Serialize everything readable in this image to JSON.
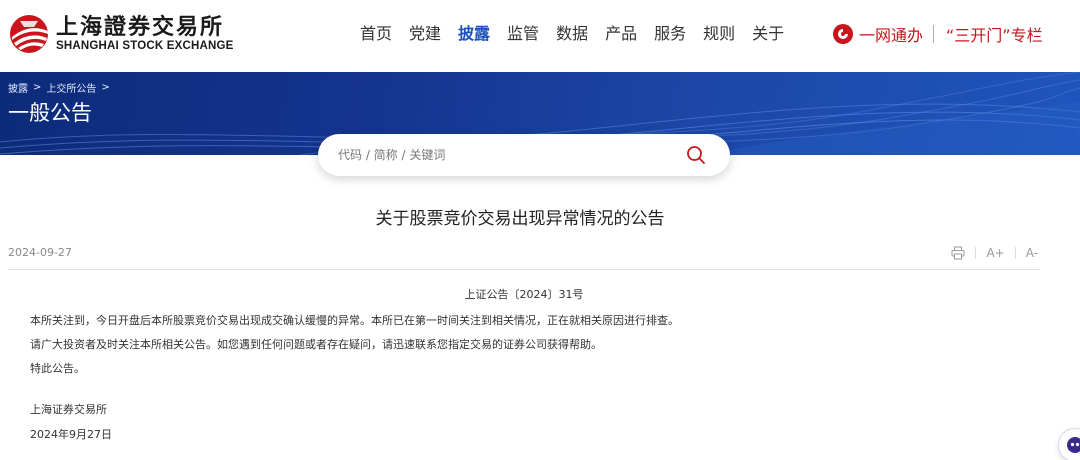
{
  "header": {
    "logo": {
      "cn": "上海證券交易所",
      "en": "SHANGHAI STOCK EXCHANGE",
      "brand_color": "#c8161d"
    },
    "nav": [
      {
        "label": "首页",
        "active": false
      },
      {
        "label": "党建",
        "active": false
      },
      {
        "label": "披露",
        "active": true
      },
      {
        "label": "监管",
        "active": false
      },
      {
        "label": "数据",
        "active": false
      },
      {
        "label": "产品",
        "active": false
      },
      {
        "label": "服务",
        "active": false
      },
      {
        "label": "规则",
        "active": false
      },
      {
        "label": "关于",
        "active": false
      }
    ],
    "quick_links": {
      "yiwangtong": "一网通办",
      "sankaimen": "“三开门”专栏",
      "icon": "seal-icon",
      "color": "#c8161d"
    },
    "active_color": "#1d52bd"
  },
  "banner": {
    "breadcrumb": [
      "披露",
      "上交所公告"
    ],
    "title": "一般公告",
    "color": "#14358f"
  },
  "search": {
    "placeholder": "代码 / 简称 / 关键词",
    "value": "",
    "icon": "search-icon",
    "icon_color": "#c8161d"
  },
  "article": {
    "title": "关于股票竞价交易出现异常情况的公告",
    "date": "2024-09-27",
    "tools": {
      "print_icon": "printer-icon",
      "font_increase": "A+",
      "font_decrease": "A-"
    },
    "doc_number": "上证公告〔2024〕31号",
    "paragraphs": [
      "本所关注到，今日开盘后本所股票竞价交易出现成交确认缓慢的异常。本所已在第一时间关注到相关情况，正在就相关原因进行排查。",
      "请广大投资者及时关注本所相关公告。如您遇到任何问题或者存在疑问，请迅速联系您指定交易的证券公司获得帮助。",
      "特此公告。"
    ],
    "signature": "上海证券交易所",
    "sign_date": "2024年9月27日"
  },
  "floating": {
    "icon": "assistant-bot-icon"
  }
}
